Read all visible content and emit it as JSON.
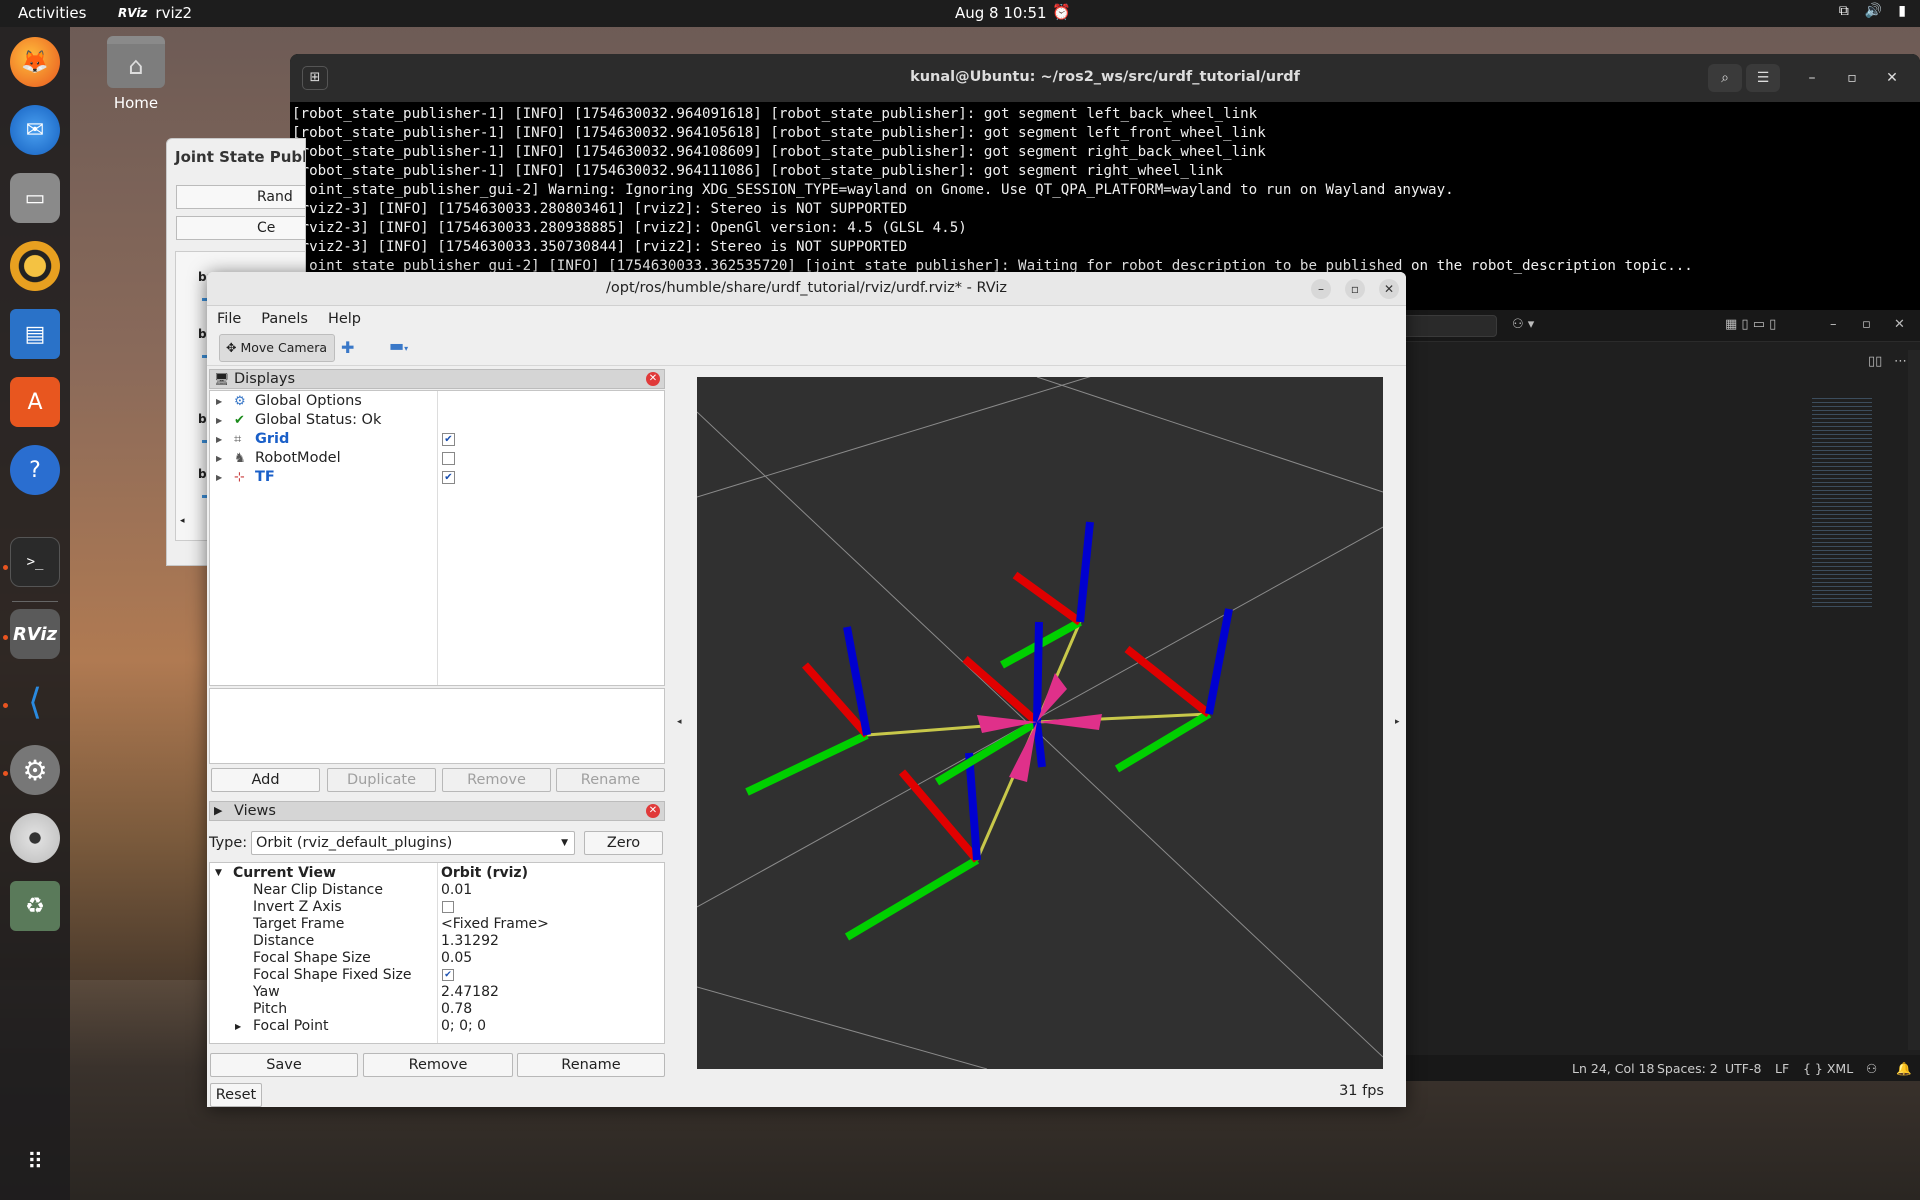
{
  "topbar": {
    "activities": "Activities",
    "app_logo": "RViz",
    "app_name": "rviz2",
    "clock": "Aug 8  10:51"
  },
  "desktop": {
    "home_label": "Home"
  },
  "dock": {
    "items": [
      "firefox-icon",
      "thunderbird-icon",
      "files-icon",
      "rhythmbox-icon",
      "writer-icon",
      "app-center-icon",
      "help-icon",
      "terminal-icon",
      "rviz-icon",
      "vscode-icon",
      "settings-icon",
      "disc-icon",
      "trash-icon",
      "app-grid-icon"
    ]
  },
  "terminal": {
    "title": "kunal@Ubuntu: ~/ros2_ws/src/urdf_tutorial/urdf",
    "lines": [
      "[robot_state_publisher-1] [INFO] [1754630032.964091618] [robot_state_publisher]: got segment left_back_wheel_link",
      "[robot_state_publisher-1] [INFO] [1754630032.964105618] [robot_state_publisher]: got segment left_front_wheel_link",
      "[robot_state_publisher-1] [INFO] [1754630032.964108609] [robot_state_publisher]: got segment right_back_wheel_link",
      "[robot_state_publisher-1] [INFO] [1754630032.964111086] [robot_state_publisher]: got segment right_wheel_link",
      "[joint_state_publisher_gui-2] Warning: Ignoring XDG_SESSION_TYPE=wayland on Gnome. Use QT_QPA_PLATFORM=wayland to run on Wayland anyway.",
      "[rviz2-3] [INFO] [1754630033.280803461] [rviz2]: Stereo is NOT SUPPORTED",
      "[rviz2-3] [INFO] [1754630033.280938885] [rviz2]: OpenGl version: 4.5 (GLSL 4.5)",
      "[rviz2-3] [INFO] [1754630033.350730844] [rviz2]: Stereo is NOT SUPPORTED",
      "[joint_state_publisher_gui-2] [INFO] [1754630033.362535720] [joint_state_publisher]: Waiting for robot_description to be published on the robot_description topic..."
    ]
  },
  "jsp": {
    "title": "Joint State Publi",
    "randomize": "Rand",
    "center": "Ce",
    "labels": [
      "ba",
      "ba",
      "ba",
      "ba"
    ]
  },
  "vscode_status": {
    "position": "Ln 24, Col 18",
    "spaces": "Spaces: 2",
    "encoding": "UTF-8",
    "eol": "LF",
    "language": "{ } XML"
  },
  "rviz": {
    "title": "/opt/ros/humble/share/urdf_tutorial/rviz/urdf.rviz* - RViz",
    "menu": [
      "File",
      "Panels",
      "Help"
    ],
    "tool_move_camera": "Move Camera",
    "displays": {
      "header": "Displays",
      "items": [
        {
          "label": "Global Options",
          "icon": "gear-icon",
          "checkbox": null,
          "blue": false
        },
        {
          "label": "Global Status: Ok",
          "icon": "check-icon",
          "checkbox": null,
          "blue": false
        },
        {
          "label": "Grid",
          "icon": "grid-icon",
          "checkbox": true,
          "blue": true
        },
        {
          "label": "RobotModel",
          "icon": "robot-icon",
          "checkbox": false,
          "blue": false
        },
        {
          "label": "TF",
          "icon": "axes-icon",
          "checkbox": true,
          "blue": true
        }
      ],
      "buttons": {
        "add": "Add",
        "duplicate": "Duplicate",
        "remove": "Remove",
        "rename": "Rename"
      }
    },
    "views": {
      "header": "Views",
      "type_label": "Type:",
      "type_value": "Orbit (rviz_default_plugins)",
      "zero": "Zero",
      "current_view": {
        "name": "Current View",
        "value": "Orbit (rviz)"
      },
      "props": [
        {
          "name": "Near Clip Distance",
          "value": "0.01"
        },
        {
          "name": "Invert Z Axis",
          "value": "",
          "checkbox": false
        },
        {
          "name": "Target Frame",
          "value": "<Fixed Frame>"
        },
        {
          "name": "Distance",
          "value": "1.31292"
        },
        {
          "name": "Focal Shape Size",
          "value": "0.05"
        },
        {
          "name": "Focal Shape Fixed Size",
          "value": "",
          "checkbox": true
        },
        {
          "name": "Yaw",
          "value": "2.47182"
        },
        {
          "name": "Pitch",
          "value": "0.78"
        },
        {
          "name": "Focal Point",
          "value": "0; 0; 0",
          "expandable": true
        }
      ],
      "buttons": {
        "save": "Save",
        "remove": "Remove",
        "rename": "Rename"
      }
    },
    "reset": "Reset",
    "fps": "31 fps"
  }
}
